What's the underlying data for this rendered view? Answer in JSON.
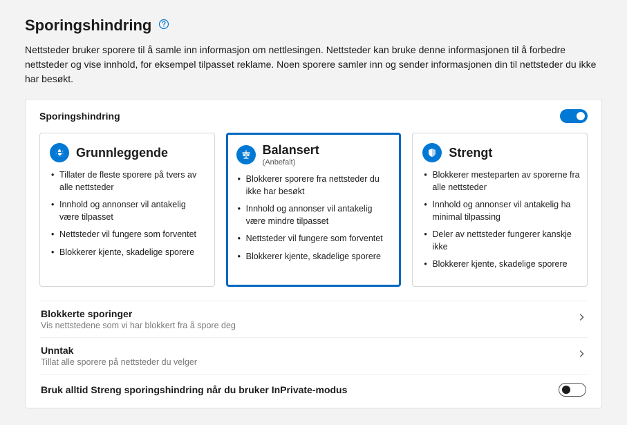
{
  "pageTitle": "Sporingshindring",
  "description": "Nettsteder bruker sporere til å samle inn informasjon om nettlesingen. Nettsteder kan bruke denne informasjonen til å forbedre nettsteder og vise innhold, for eksempel tilpasset reklame. Noen sporere samler inn og sender informasjonen din til nettsteder du ikke har besøkt.",
  "panel": {
    "title": "Sporingshindring",
    "toggleOn": true
  },
  "cards": [
    {
      "id": "basic",
      "title": "Grunnleggende",
      "subtitle": "",
      "icon": "globe-icon",
      "selected": false,
      "bullets": [
        "Tillater de fleste sporere på tvers av alle nettsteder",
        "Innhold og annonser vil antakelig være tilpasset",
        "Nettsteder vil fungere som forventet",
        "Blokkerer kjente, skadelige sporere"
      ]
    },
    {
      "id": "balanced",
      "title": "Balansert",
      "subtitle": "(Anbefalt)",
      "icon": "scales-icon",
      "selected": true,
      "bullets": [
        "Blokkerer sporere fra nettsteder du ikke har besøkt",
        "Innhold og annonser vil antakelig være mindre tilpasset",
        "Nettsteder vil fungere som forventet",
        "Blokkerer kjente, skadelige sporere"
      ]
    },
    {
      "id": "strict",
      "title": "Strengt",
      "subtitle": "",
      "icon": "shield-icon",
      "selected": false,
      "bullets": [
        "Blokkerer mesteparten av sporerne fra alle nettsteder",
        "Innhold og annonser vil antakelig ha minimal tilpassing",
        "Deler av nettsteder fungerer kanskje ikke",
        "Blokkerer kjente, skadelige sporere"
      ]
    }
  ],
  "rows": {
    "blocked": {
      "title": "Blokkerte sporinger",
      "subtitle": "Vis nettstedene som vi har blokkert fra å spore deg"
    },
    "exceptions": {
      "title": "Unntak",
      "subtitle": "Tillat alle sporere på nettsteder du velger"
    },
    "inprivate": {
      "title": "Bruk alltid Streng sporingshindring når du bruker InPrivate-modus",
      "toggleOn": false
    }
  }
}
